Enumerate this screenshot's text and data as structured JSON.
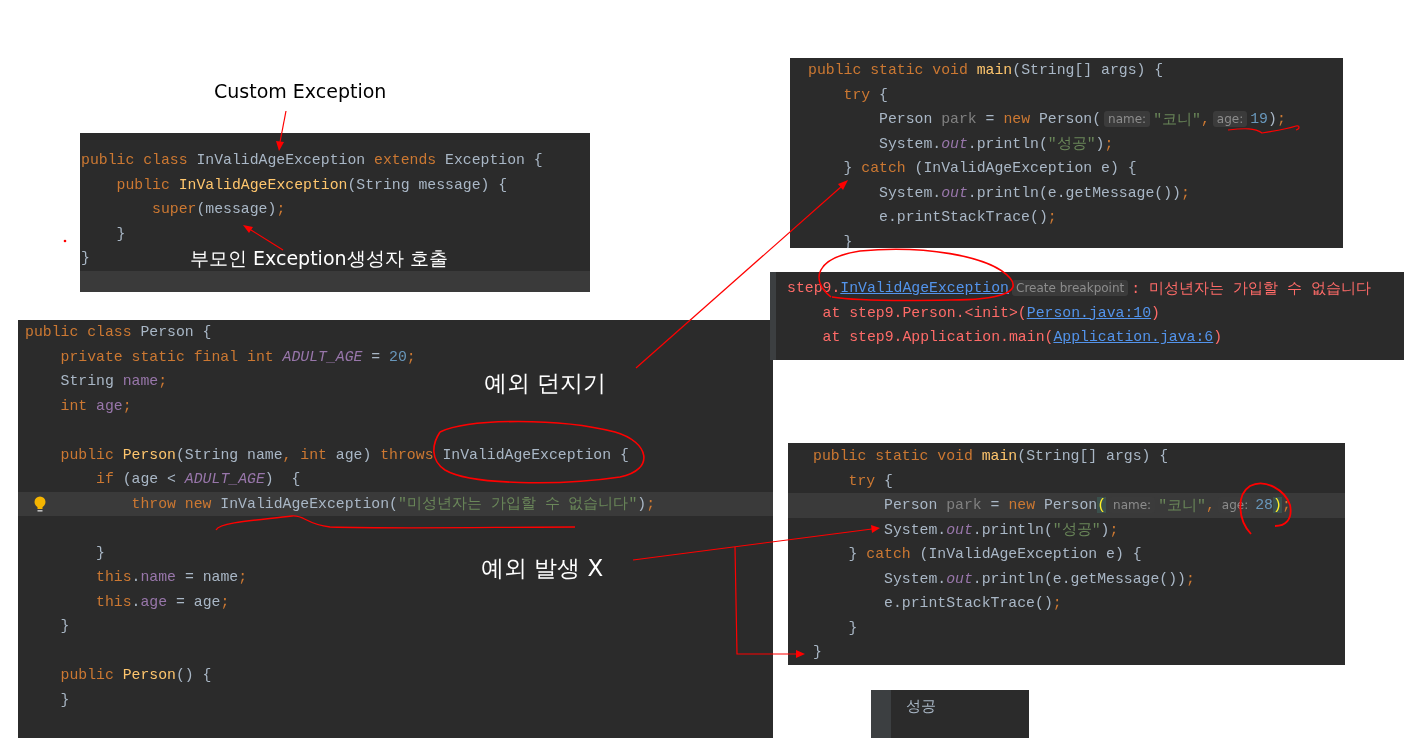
{
  "panels": [
    {
      "kind": "editor",
      "lines": [
        {
          "current": false,
          "tokens": [
            {
              "kind": "keyword",
              "text": "public class "
            },
            {
              "kind": "plain",
              "text": "InValidAgeException "
            },
            {
              "kind": "keyword",
              "text": "extends "
            },
            {
              "kind": "plain",
              "text": "Exception {"
            }
          ]
        },
        {
          "current": false,
          "tokens": [
            {
              "kind": "keyword",
              "text": "    public "
            },
            {
              "kind": "declaration",
              "text": "InValidAgeException"
            },
            {
              "kind": "plain",
              "text": "(String message) {"
            }
          ]
        },
        {
          "current": false,
          "tokens": [
            {
              "kind": "keyword",
              "text": "        super"
            },
            {
              "kind": "plain",
              "text": "(message)"
            },
            {
              "kind": "keyword",
              "text": ";"
            }
          ]
        },
        {
          "current": false,
          "tokens": [
            {
              "kind": "plain",
              "text": "    }"
            }
          ]
        },
        {
          "current": false,
          "tokens": [
            {
              "kind": "plain",
              "text": "}"
            }
          ]
        },
        {
          "current": true
        }
      ]
    },
    {
      "kind": "editor",
      "lines": [
        {
          "current": false,
          "tokens": [
            {
              "kind": "keyword",
              "text": "public class "
            },
            {
              "kind": "plain",
              "text": "Person {"
            }
          ]
        },
        {
          "current": false,
          "tokens": [
            {
              "kind": "keyword",
              "text": "    private static final int "
            },
            {
              "kind": "static",
              "text": "ADULT_AGE"
            },
            {
              "kind": "plain",
              "text": " = "
            },
            {
              "kind": "number",
              "text": "20"
            },
            {
              "kind": "keyword",
              "text": ";"
            }
          ]
        },
        {
          "current": false,
          "tokens": [
            {
              "kind": "plain",
              "text": "    String "
            },
            {
              "kind": "field",
              "text": "name"
            },
            {
              "kind": "keyword",
              "text": ";"
            }
          ]
        },
        {
          "current": false,
          "tokens": [
            {
              "kind": "keyword",
              "text": "    int "
            },
            {
              "kind": "field",
              "text": "age"
            },
            {
              "kind": "keyword",
              "text": ";"
            }
          ]
        },
        {
          "current": false
        },
        {
          "current": false,
          "tokens": [
            {
              "kind": "keyword",
              "text": "    public "
            },
            {
              "kind": "declaration",
              "text": "Person"
            },
            {
              "kind": "plain",
              "text": "(String name"
            },
            {
              "kind": "keyword",
              "text": ", int "
            },
            {
              "kind": "plain",
              "text": "age) "
            },
            {
              "kind": "keyword",
              "text": "throws "
            },
            {
              "kind": "plain",
              "text": "InValidAgeException {"
            }
          ]
        },
        {
          "current": false,
          "tokens": [
            {
              "kind": "keyword",
              "text": "        if "
            },
            {
              "kind": "plain",
              "text": "(age < "
            },
            {
              "kind": "static",
              "text": "ADULT_AGE"
            },
            {
              "kind": "plain",
              "text": ")  {"
            }
          ]
        },
        {
          "current": true,
          "bulb": true,
          "tokens": [
            {
              "kind": "keyword",
              "text": "            throw new "
            },
            {
              "kind": "plain",
              "text": "InValidAgeException("
            },
            {
              "kind": "string",
              "text": "\"미성년자는 가입할 수 없습니다\""
            },
            {
              "kind": "plain",
              "text": ")"
            },
            {
              "kind": "keyword",
              "text": ";"
            }
          ]
        },
        {
          "current": false
        },
        {
          "current": false,
          "tokens": [
            {
              "kind": "plain",
              "text": "        }"
            }
          ]
        },
        {
          "current": false,
          "tokens": [
            {
              "kind": "keyword",
              "text": "        this"
            },
            {
              "kind": "plain",
              "text": "."
            },
            {
              "kind": "field",
              "text": "name"
            },
            {
              "kind": "plain",
              "text": " = name"
            },
            {
              "kind": "keyword",
              "text": ";"
            }
          ]
        },
        {
          "current": false,
          "tokens": [
            {
              "kind": "keyword",
              "text": "        this"
            },
            {
              "kind": "plain",
              "text": "."
            },
            {
              "kind": "field",
              "text": "age"
            },
            {
              "kind": "plain",
              "text": " = age"
            },
            {
              "kind": "keyword",
              "text": ";"
            }
          ]
        },
        {
          "current": false,
          "tokens": [
            {
              "kind": "plain",
              "text": "    }"
            }
          ]
        },
        {
          "current": false
        },
        {
          "current": false,
          "tokens": [
            {
              "kind": "keyword",
              "text": "    public "
            },
            {
              "kind": "declaration",
              "text": "Person"
            },
            {
              "kind": "plain",
              "text": "() {"
            }
          ]
        },
        {
          "current": false,
          "tokens": [
            {
              "kind": "plain",
              "text": "    }"
            }
          ]
        }
      ]
    },
    {
      "kind": "editor",
      "lines": [
        {
          "current": false,
          "tokens": [
            {
              "kind": "keyword",
              "text": "public static void "
            },
            {
              "kind": "declaration",
              "text": "main"
            },
            {
              "kind": "plain",
              "text": "(String[] args) {"
            }
          ]
        },
        {
          "current": false,
          "tokens": [
            {
              "kind": "keyword",
              "text": "    try "
            },
            {
              "kind": "plain",
              "text": "{"
            }
          ]
        },
        {
          "current": false,
          "tokens": [
            {
              "kind": "plain",
              "text": "        Person "
            },
            {
              "kind": "unused",
              "text": "park"
            },
            {
              "kind": "plain",
              "text": " = "
            },
            {
              "kind": "keyword",
              "text": "new "
            },
            {
              "kind": "plain",
              "text": "Person("
            },
            {
              "kind": "hint",
              "text": "name:"
            },
            {
              "kind": "string",
              "text": "\"코니\""
            },
            {
              "kind": "keyword",
              "text": ","
            },
            {
              "kind": "hint",
              "text": "age:"
            },
            {
              "kind": "number",
              "text": "19"
            },
            {
              "kind": "plain",
              "text": ")"
            },
            {
              "kind": "keyword",
              "text": ";"
            }
          ]
        },
        {
          "current": false,
          "tokens": [
            {
              "kind": "plain",
              "text": "        System."
            },
            {
              "kind": "static",
              "text": "out"
            },
            {
              "kind": "plain",
              "text": ".println("
            },
            {
              "kind": "string",
              "text": "\"성공\""
            },
            {
              "kind": "plain",
              "text": ")"
            },
            {
              "kind": "keyword",
              "text": ";"
            }
          ]
        },
        {
          "current": false,
          "tokens": [
            {
              "kind": "plain",
              "text": "    } "
            },
            {
              "kind": "keyword",
              "text": "catch "
            },
            {
              "kind": "plain",
              "text": "(InValidAgeException e) {"
            }
          ]
        },
        {
          "current": false,
          "tokens": [
            {
              "kind": "plain",
              "text": "        System."
            },
            {
              "kind": "static",
              "text": "out"
            },
            {
              "kind": "plain",
              "text": ".println(e.getMessage())"
            },
            {
              "kind": "keyword",
              "text": ";"
            }
          ]
        },
        {
          "current": false,
          "tokens": [
            {
              "kind": "plain",
              "text": "        e.printStackTrace()"
            },
            {
              "kind": "keyword",
              "text": ";"
            }
          ]
        },
        {
          "current": false,
          "tokens": [
            {
              "kind": "plain",
              "text": "    }"
            }
          ]
        }
      ]
    },
    {
      "kind": "console",
      "lines": [
        {
          "current": false,
          "tokens": [
            {
              "kind": "error",
              "text": "step9."
            },
            {
              "kind": "link",
              "text": "InValidAgeException"
            },
            {
              "kind": "hint",
              "text": "Create breakpoint"
            },
            {
              "kind": "error",
              "text": ": 미성년자는 가입할 수 없습니다"
            }
          ]
        },
        {
          "current": false,
          "tokens": [
            {
              "kind": "error",
              "text": "    at step9.Person.<init>("
            },
            {
              "kind": "link",
              "text": "Person.java:10"
            },
            {
              "kind": "error",
              "text": ")"
            }
          ]
        },
        {
          "current": false,
          "tokens": [
            {
              "kind": "error",
              "text": "    at step9.Application.main("
            },
            {
              "kind": "link",
              "text": "Application.java:6"
            },
            {
              "kind": "error",
              "text": ")"
            }
          ]
        }
      ]
    },
    {
      "kind": "editor",
      "lines": [
        {
          "current": false,
          "tokens": [
            {
              "kind": "keyword",
              "text": "public static void "
            },
            {
              "kind": "declaration",
              "text": "main"
            },
            {
              "kind": "plain",
              "text": "(String[] args) {"
            }
          ]
        },
        {
          "current": false,
          "tokens": [
            {
              "kind": "keyword",
              "text": "    try "
            },
            {
              "kind": "plain",
              "text": "{"
            }
          ]
        },
        {
          "current": true,
          "tokens": [
            {
              "kind": "plain",
              "text": "        Person "
            },
            {
              "kind": "unused",
              "text": "park"
            },
            {
              "kind": "plain",
              "text": " = "
            },
            {
              "kind": "keyword",
              "text": "new "
            },
            {
              "kind": "plain",
              "text": "Person"
            },
            {
              "kind": "match",
              "text": "("
            },
            {
              "kind": "hint",
              "text": "name:"
            },
            {
              "kind": "string",
              "text": "\"코니\""
            },
            {
              "kind": "keyword",
              "text": ","
            },
            {
              "kind": "hint",
              "text": "age:"
            },
            {
              "kind": "number",
              "text": "28"
            },
            {
              "kind": "match",
              "text": ")"
            },
            {
              "kind": "keyword",
              "text": ";"
            }
          ]
        },
        {
          "current": false,
          "tokens": [
            {
              "kind": "plain",
              "text": "        System."
            },
            {
              "kind": "static",
              "text": "out"
            },
            {
              "kind": "plain",
              "text": ".println("
            },
            {
              "kind": "string",
              "text": "\"성공\""
            },
            {
              "kind": "plain",
              "text": ")"
            },
            {
              "kind": "keyword",
              "text": ";"
            }
          ]
        },
        {
          "current": false,
          "tokens": [
            {
              "kind": "plain",
              "text": "    } "
            },
            {
              "kind": "keyword",
              "text": "catch "
            },
            {
              "kind": "plain",
              "text": "(InValidAgeException e) {"
            }
          ]
        },
        {
          "current": false,
          "tokens": [
            {
              "kind": "plain",
              "text": "        System."
            },
            {
              "kind": "static",
              "text": "out"
            },
            {
              "kind": "plain",
              "text": ".println(e.getMessage())"
            },
            {
              "kind": "keyword",
              "text": ";"
            }
          ]
        },
        {
          "current": false,
          "tokens": [
            {
              "kind": "plain",
              "text": "        e.printStackTrace()"
            },
            {
              "kind": "keyword",
              "text": ";"
            }
          ]
        },
        {
          "current": false,
          "tokens": [
            {
              "kind": "plain",
              "text": "    }"
            }
          ]
        },
        {
          "current": false,
          "tokens": [
            {
              "kind": "plain",
              "text": "}"
            }
          ]
        }
      ]
    },
    {
      "kind": "output",
      "lines": [
        {
          "current": false,
          "tokens": [
            {
              "kind": "plain",
              "text": "성공"
            }
          ]
        }
      ]
    }
  ],
  "annotations": [
    {
      "text": "Custom Exception"
    },
    {
      "text": "부모인 Exception생성자 호출"
    },
    {
      "text": "예외 던지기"
    },
    {
      "text": "예외 발생 X"
    }
  ]
}
